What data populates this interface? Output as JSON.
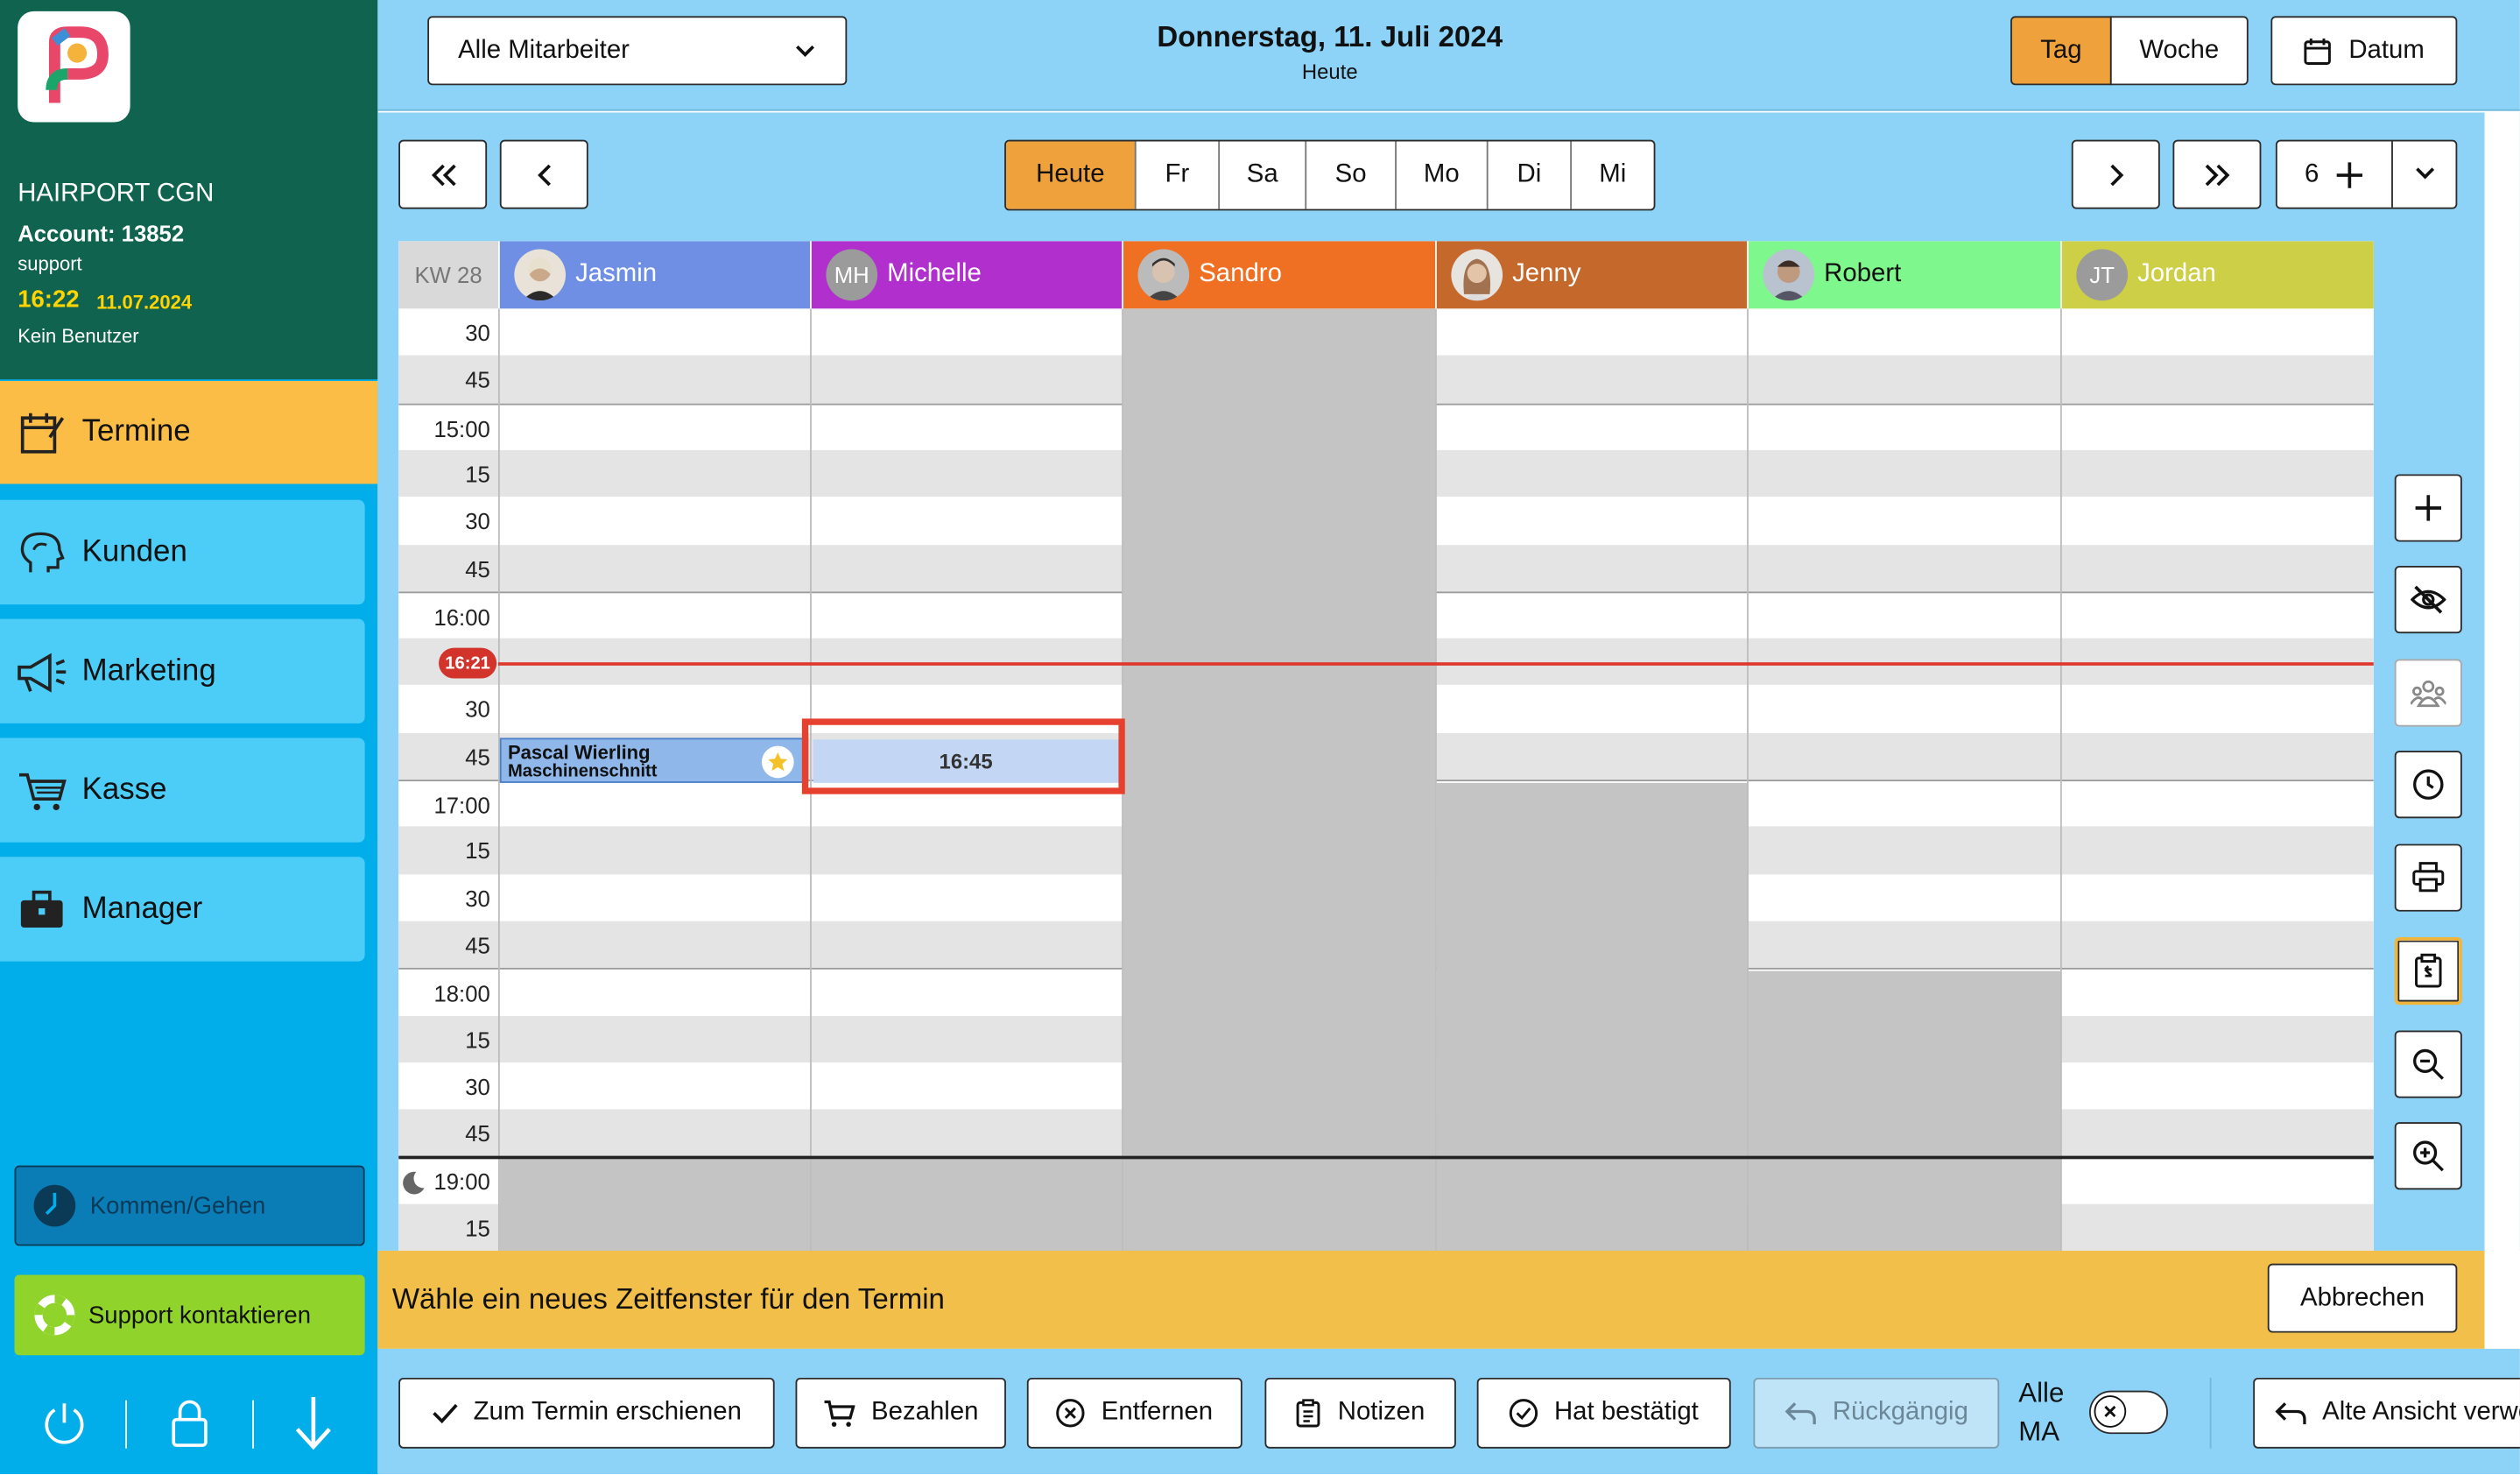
{
  "sidebar": {
    "salon": "HAIRPORT CGN",
    "account": "Account: 13852",
    "user_role": "support",
    "time": "16:22",
    "date": "11.07.2024",
    "user": "Kein Benutzer",
    "nav": [
      {
        "label": "Termine",
        "icon": "calendar-edit-icon",
        "active": true
      },
      {
        "label": "Kunden",
        "icon": "customer-head-icon",
        "active": false
      },
      {
        "label": "Marketing",
        "icon": "megaphone-icon",
        "active": false
      },
      {
        "label": "Kasse",
        "icon": "cart-icon",
        "active": false
      },
      {
        "label": "Manager",
        "icon": "briefcase-icon",
        "active": false
      }
    ],
    "kommen_gehen": "Kommen/Gehen",
    "support": "Support kontaktieren",
    "colors": {
      "header": "#10634f",
      "active": "#fbbd45",
      "bg": "#02aeea",
      "item": "#4bcdf7",
      "support": "#8fd32b"
    }
  },
  "header": {
    "staff_select": "Alle Mitarbeiter",
    "date_title": "Donnerstag, 11. Juli 2024",
    "date_sub": "Heute",
    "view_day": "Tag",
    "view_week": "Woche",
    "date_button": "Datum"
  },
  "daynav": {
    "days": [
      "Heute",
      "Fr",
      "Sa",
      "So",
      "Mo",
      "Di",
      "Mi"
    ],
    "columns_count": "6"
  },
  "calendar": {
    "week": "KW 28",
    "now_label": "16:21",
    "staff": [
      {
        "name": "Jasmin",
        "initials": "",
        "color": "#6e8fe4",
        "photo": true
      },
      {
        "name": "Michelle",
        "initials": "MH",
        "color": "#b12fcc",
        "photo": false
      },
      {
        "name": "Sandro",
        "initials": "",
        "color": "#ef6f23",
        "photo": true
      },
      {
        "name": "Jenny",
        "initials": "",
        "color": "#c5682c",
        "photo": true
      },
      {
        "name": "Robert",
        "initials": "",
        "color": "#7ef78c",
        "photo": true
      },
      {
        "name": "Jordan",
        "initials": "JT",
        "color": "#cdcf46",
        "photo": false
      }
    ],
    "times": [
      "30",
      "45",
      "15:00",
      "15",
      "30",
      "45",
      "16:00",
      "",
      "30",
      "45",
      "17:00",
      "15",
      "30",
      "45",
      "18:00",
      "15",
      "30",
      "45",
      "19:00",
      "15"
    ],
    "appointment": {
      "name": "Pascal Wierling",
      "service": "Maschinenschnitt"
    },
    "selected_slot": "16:45"
  },
  "banner": {
    "text": "Wähle ein neues Zeitfenster für den Termin",
    "cancel": "Abbrechen"
  },
  "actions": {
    "arrived": "Zum Termin erschienen",
    "pay": "Bezahlen",
    "remove": "Entfernen",
    "notes": "Notizen",
    "confirmed": "Hat bestätigt",
    "undo": "Rückgängig",
    "all_ma_1": "Alle",
    "all_ma_2": "MA",
    "old_view": "Alte Ansicht verwenden"
  }
}
